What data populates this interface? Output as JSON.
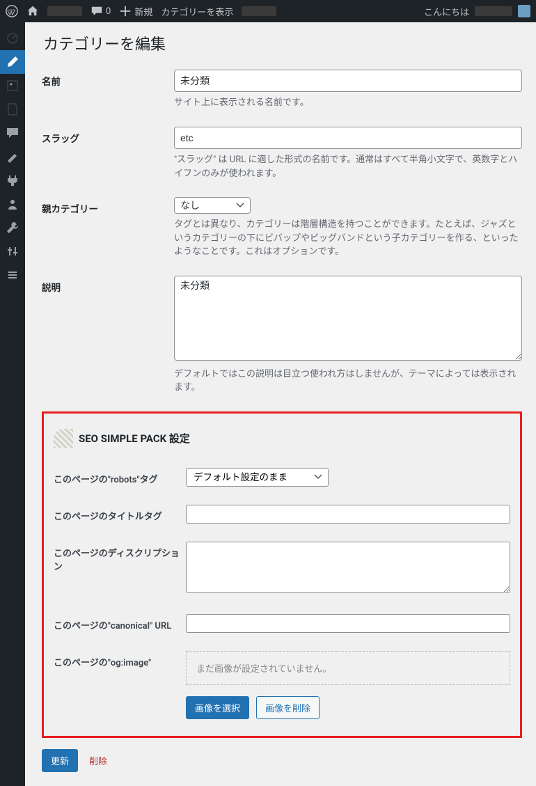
{
  "adminbar": {
    "comments_count": "0",
    "new_label": "新規",
    "view_cats_label": "カテゴリーを表示",
    "greeting": "こんにちは"
  },
  "page": {
    "title": "カテゴリーを編集"
  },
  "fields": {
    "name": {
      "label": "名前",
      "value": "未分類",
      "desc": "サイト上に表示される名前です。"
    },
    "slug": {
      "label": "スラッグ",
      "value": "etc",
      "desc": "\"スラッグ\" は URL に適した形式の名前です。通常はすべて半角小文字で、英数字とハイフンのみが使われます。"
    },
    "parent": {
      "label": "親カテゴリー",
      "value": "なし",
      "desc": "タグとは異なり、カテゴリーは階層構造を持つことができます。たとえば、ジャズというカテゴリーの下にビバップやビッグバンドという子カテゴリーを作る、といったようなことです。これはオプションです。"
    },
    "description": {
      "label": "説明",
      "value": "未分類",
      "desc": "デフォルトではこの説明は目立つ使われ方はしませんが、テーマによっては表示されます。"
    }
  },
  "seo": {
    "heading": "SEO SIMPLE PACK 設定",
    "robots": {
      "label": "このページの\"robots\"タグ",
      "value": "デフォルト設定のまま"
    },
    "title_tag": {
      "label": "このページのタイトルタグ",
      "value": ""
    },
    "meta_desc": {
      "label": "このページのディスクリプション",
      "value": ""
    },
    "canonical": {
      "label": "このページの\"canonical\" URL",
      "value": ""
    },
    "ogimage": {
      "label": "このページの\"og:image\"",
      "empty_msg": "まだ画像が設定されていません。",
      "select_btn": "画像を選択",
      "remove_btn": "画像を削除"
    }
  },
  "actions": {
    "update": "更新",
    "delete": "削除"
  }
}
